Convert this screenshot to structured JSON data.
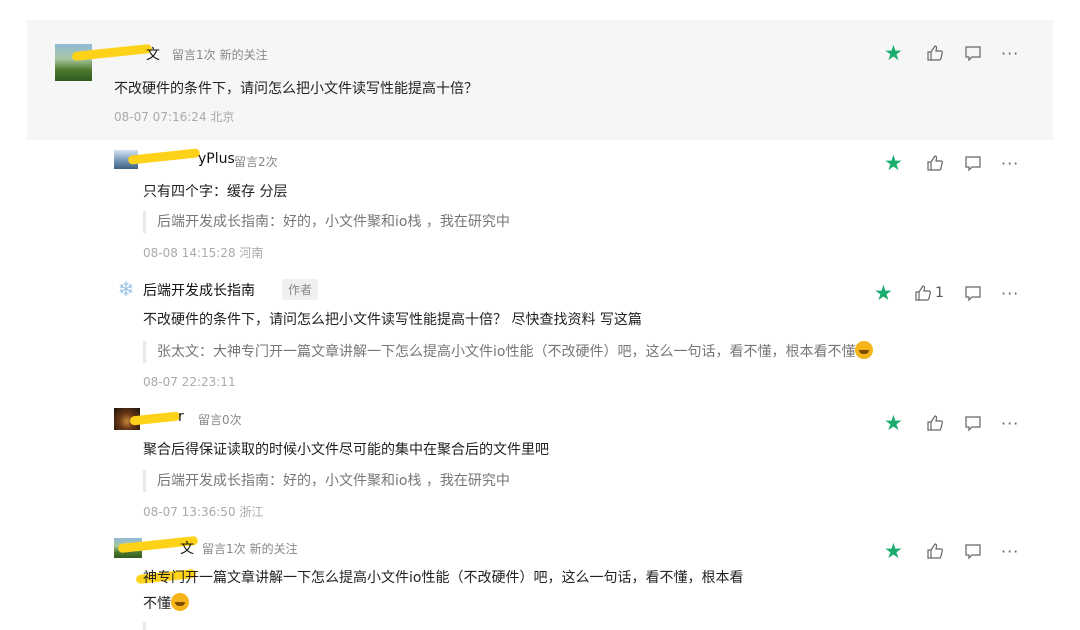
{
  "colors": {
    "accent": "#1aad6e",
    "highlight_bg": "#f6f6f6",
    "redaction": "#ffd21a"
  },
  "icons": [
    "star-icon",
    "thumbs-up-icon",
    "comment-icon",
    "more-icon",
    "emoji-icon"
  ],
  "main_comment": {
    "name": "文",
    "meta": [
      "留言1次",
      "新的关注"
    ],
    "body": "不改硬件的条件下，请问怎么把小文件读写性能提高十倍？",
    "time": "08-07 07:16:24 北京"
  },
  "replies": [
    {
      "name": "yPlus",
      "meta": [
        "留言2次"
      ],
      "body": "只有四个字：缓存 分层",
      "quoted_reply": "后端开发成长指南：好的，小文件聚和io栈 ，我在研究中",
      "time": "08-08 14:15:28 河南"
    },
    {
      "name": "后端开发成长指南",
      "badge": "作者",
      "body": "不改硬件的条件下，请问怎么把小文件读写性能提高十倍？ 尽快查找资料 写这篇",
      "quoted_reply": "张太文：大神专门开一篇文章讲解一下怎么提高小文件io性能（不改硬件）吧，这么一句话，看不懂，根本看不懂",
      "time": "08-07 22:23:11",
      "likes": "1"
    },
    {
      "name": "r",
      "meta": [
        "留言0次"
      ],
      "body": "聚合后得保证读取的时候小文件尽可能的集中在聚合后的文件里吧",
      "quoted_reply": "后端开发成长指南：好的，小文件聚和io栈 ，我在研究中",
      "time": "08-07 13:36:50 浙江"
    },
    {
      "name": "文",
      "meta": [
        "留言1次",
        "新的关注"
      ],
      "body_line1": "神专门开一篇文章讲解一下怎么提高小文件io性能（不改硬件）吧，这么一句话，看不懂，根本看",
      "body_line2": "不懂"
    }
  ]
}
